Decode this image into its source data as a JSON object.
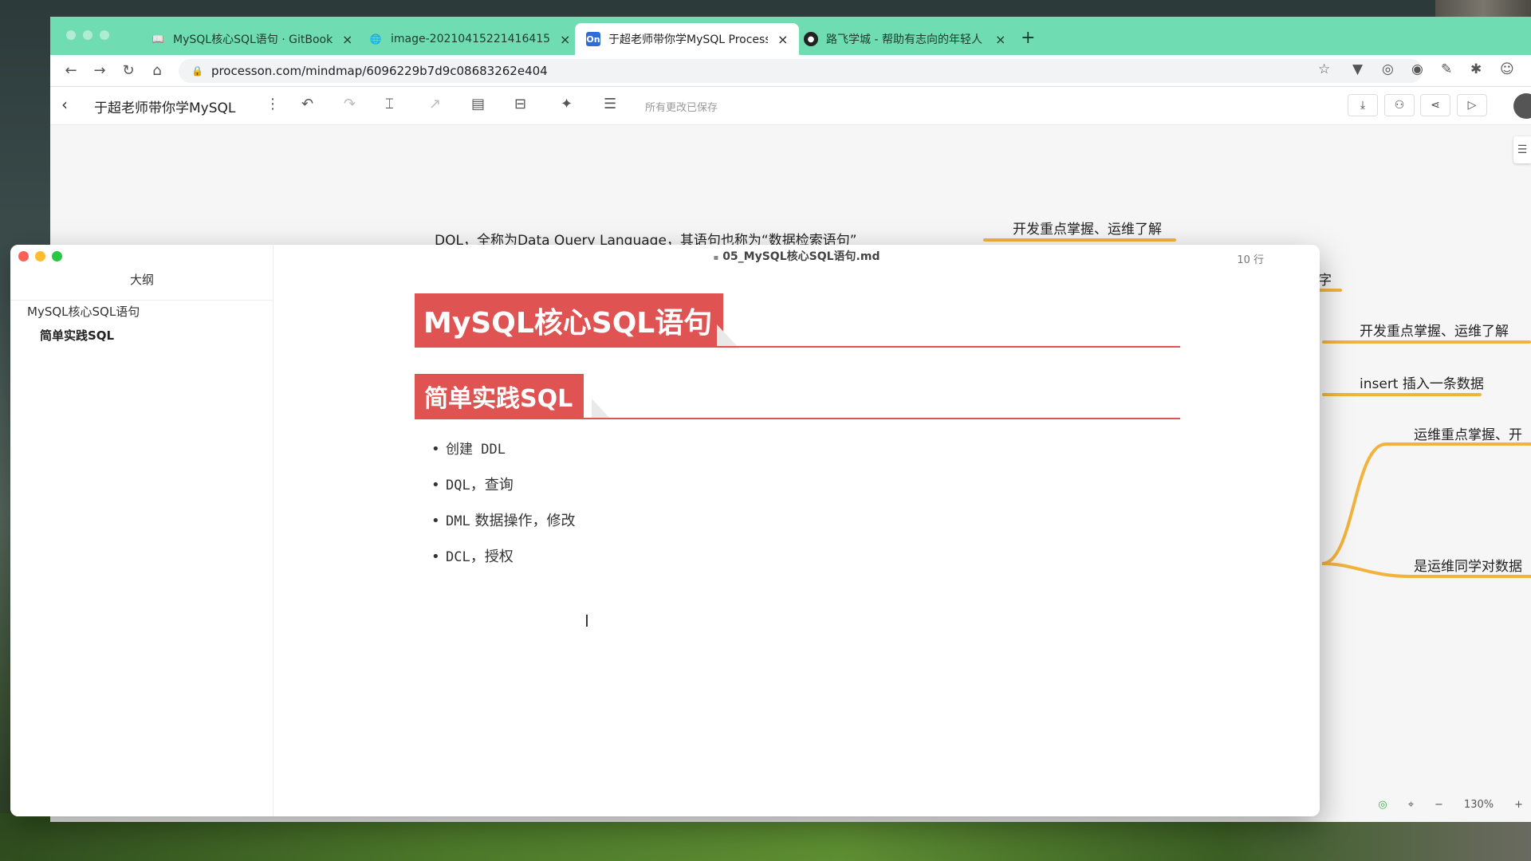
{
  "browser": {
    "tabs": [
      {
        "title": "MySQL核心SQL语句 · GitBook",
        "icon": "book-icon"
      },
      {
        "title": "image-20210415221416415.png",
        "icon": "globe-icon"
      },
      {
        "title": "于超老师带你学MySQL ProcessOn",
        "icon": "processon-icon",
        "icon_text": "On"
      },
      {
        "title": "路飞学城 - 帮助有志向的年轻人",
        "icon": "luffy-icon"
      }
    ],
    "close_glyph": "×",
    "new_tab_glyph": "+",
    "url": "processon.com/mindmap/6096229b7d9c08683262e404"
  },
  "processon": {
    "doc_title": "于超老师带你学MySQL",
    "saved_status": "所有更改已保存",
    "zoom": "130%",
    "mindmap_nodes": [
      "DQL，全称为Data Query Language，其语句也称为“数据检索语句”",
      "开发重点掌握、运维了解",
      "字",
      "开发重点掌握、运维了解",
      "insert 插入一条数据",
      "运维重点掌握、开",
      "是运维同学对数据"
    ]
  },
  "typora": {
    "file_title": "05_MySQL核心SQL语句.md",
    "line_count": "10 行",
    "outline_header": "大纲",
    "outline_items": [
      "MySQL核心SQL语句",
      "简单实践SQL"
    ],
    "h1": "MySQL核心SQL语句",
    "h2": "简单实践SQL",
    "bullets": [
      {
        "code": "创建 DDL",
        "text": ""
      },
      {
        "code": "DQL",
        "text": "，查询"
      },
      {
        "code": "DML",
        "text": " 数据操作，修改"
      },
      {
        "code": "DCL",
        "text": "，授权"
      }
    ]
  },
  "colors": {
    "tabbar": "#6fdcb2",
    "heading_red": "#e05353",
    "mindmap_line": "#f2b33d"
  }
}
